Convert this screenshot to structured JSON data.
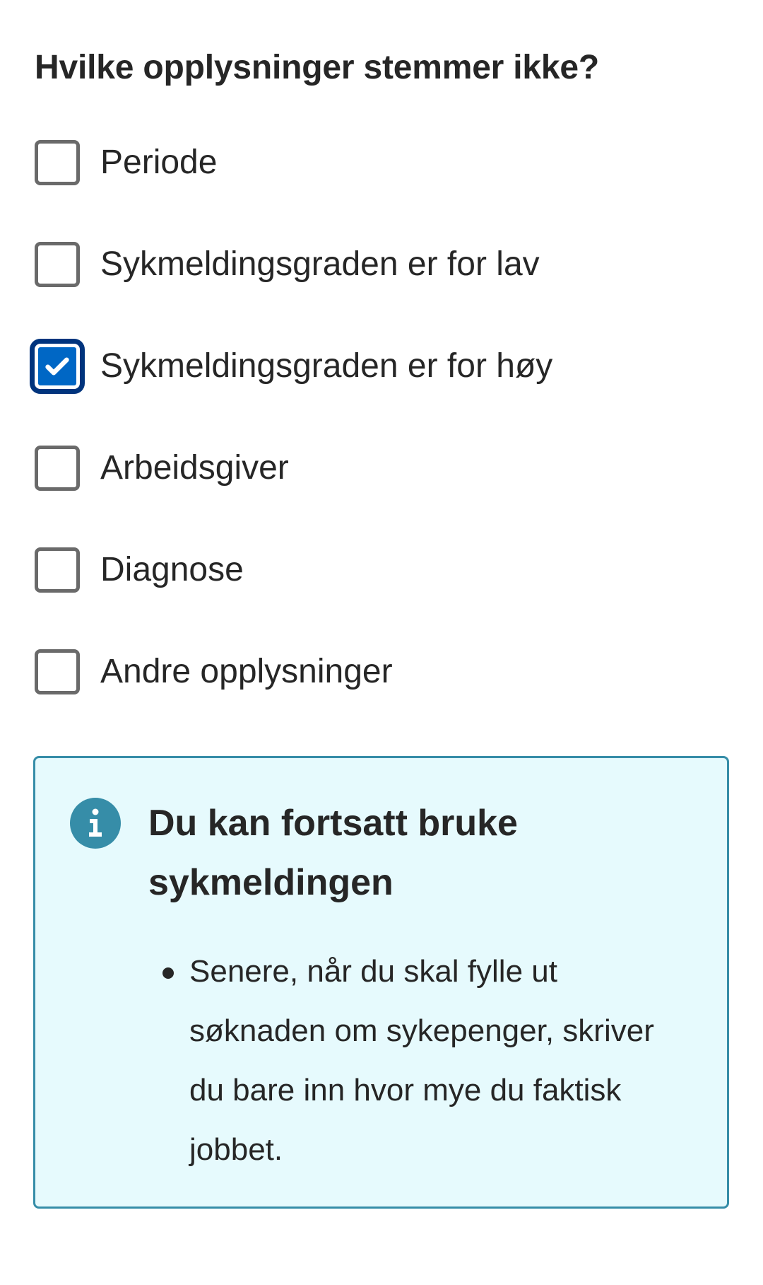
{
  "form": {
    "question": "Hvilke opplysninger stemmer ikke?",
    "options": [
      {
        "label": "Periode",
        "checked": false
      },
      {
        "label": "Sykmeldingsgraden er for lav",
        "checked": false
      },
      {
        "label": "Sykmeldingsgraden er for høy",
        "checked": true
      },
      {
        "label": "Arbeidsgiver",
        "checked": false
      },
      {
        "label": "Diagnose",
        "checked": false
      },
      {
        "label": "Andre opplysninger",
        "checked": false
      }
    ]
  },
  "alert": {
    "icon": "info-icon",
    "title": "Du kan fortsatt bruke sykmeldingen",
    "items": [
      "Senere, når du skal fylle ut søknaden om sykepenger, skriver du bare inn hvor mye du faktisk jobbet."
    ]
  },
  "colors": {
    "checkbox_checked_fill": "#0067c5",
    "checkbox_checked_ring": "#00347d",
    "checkbox_border": "#6a6a6a",
    "alert_background": "#e6fafd",
    "alert_border": "#368da8",
    "info_icon": "#368da8",
    "text": "#262626"
  }
}
